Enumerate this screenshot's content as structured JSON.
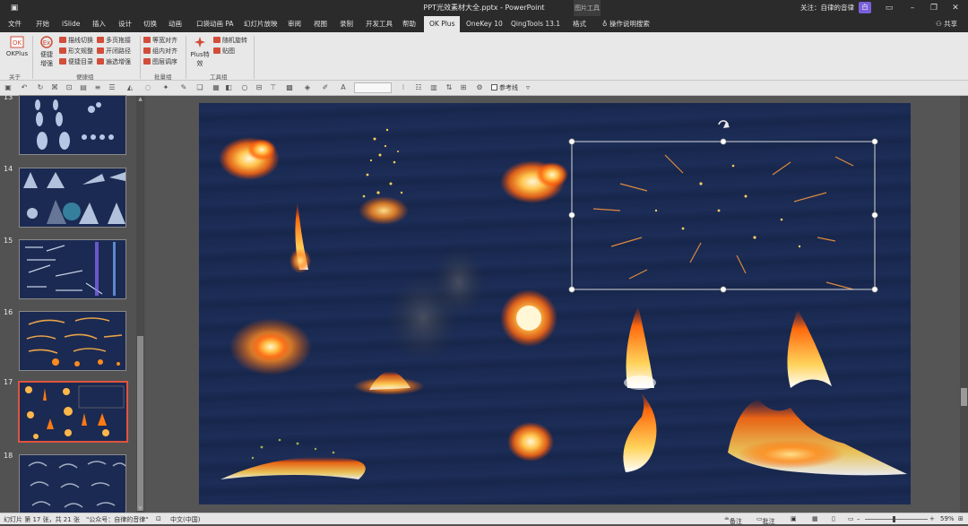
{
  "window": {
    "title": "PPT光效素材大全.pptx  -  PowerPoint",
    "context_tab": "图片工具",
    "user_label": "关注：自律的音律",
    "avatar_text": "白"
  },
  "tabs": [
    "文件",
    "开始",
    "iSlide",
    "插入",
    "设计",
    "切换",
    "动画",
    "口袋动画 PA",
    "幻灯片放映",
    "审阅",
    "视图",
    "录制",
    "开发工具",
    "帮助",
    "OK Plus",
    "OneKey 10",
    "QingTools 13.1",
    "格式"
  ],
  "active_tab": "OK Plus",
  "tell_me": "操作说明搜索",
  "share": "共享",
  "ribbon": {
    "okplus_label": "OKPlus",
    "about_group": "关于",
    "quick_label": "便捷\n增强",
    "col1": [
      "描线切换",
      "形文规整",
      "便捷目录"
    ],
    "col2": [
      "多页拖接",
      "开闭路径",
      "遍选增强"
    ],
    "convenience_group": "便捷组",
    "col3": [
      "等宽对齐",
      "组内对齐",
      "图层调序"
    ],
    "batch_group": "批量组",
    "plus_label": "Plus特效",
    "col4": [
      "随机旋转",
      "贴图"
    ],
    "tools_group": "工具组"
  },
  "quickbar": {
    "guides_label": "参考线"
  },
  "slides": [
    {
      "num": "13"
    },
    {
      "num": "14"
    },
    {
      "num": "15"
    },
    {
      "num": "16"
    },
    {
      "num": "17",
      "selected": true
    },
    {
      "num": "18"
    }
  ],
  "status": {
    "slide_info": "幻灯片 第 17 张，共 21 张",
    "theme": "\"公众号：自律的音律\"",
    "language": "中文(中国)",
    "notes": "备注",
    "comments": "批注",
    "zoom": "59%"
  },
  "colors": {
    "accent_selection": "#e0543e",
    "titlebar": "#2b2b2b",
    "slide_bg": "#1b2b54"
  }
}
